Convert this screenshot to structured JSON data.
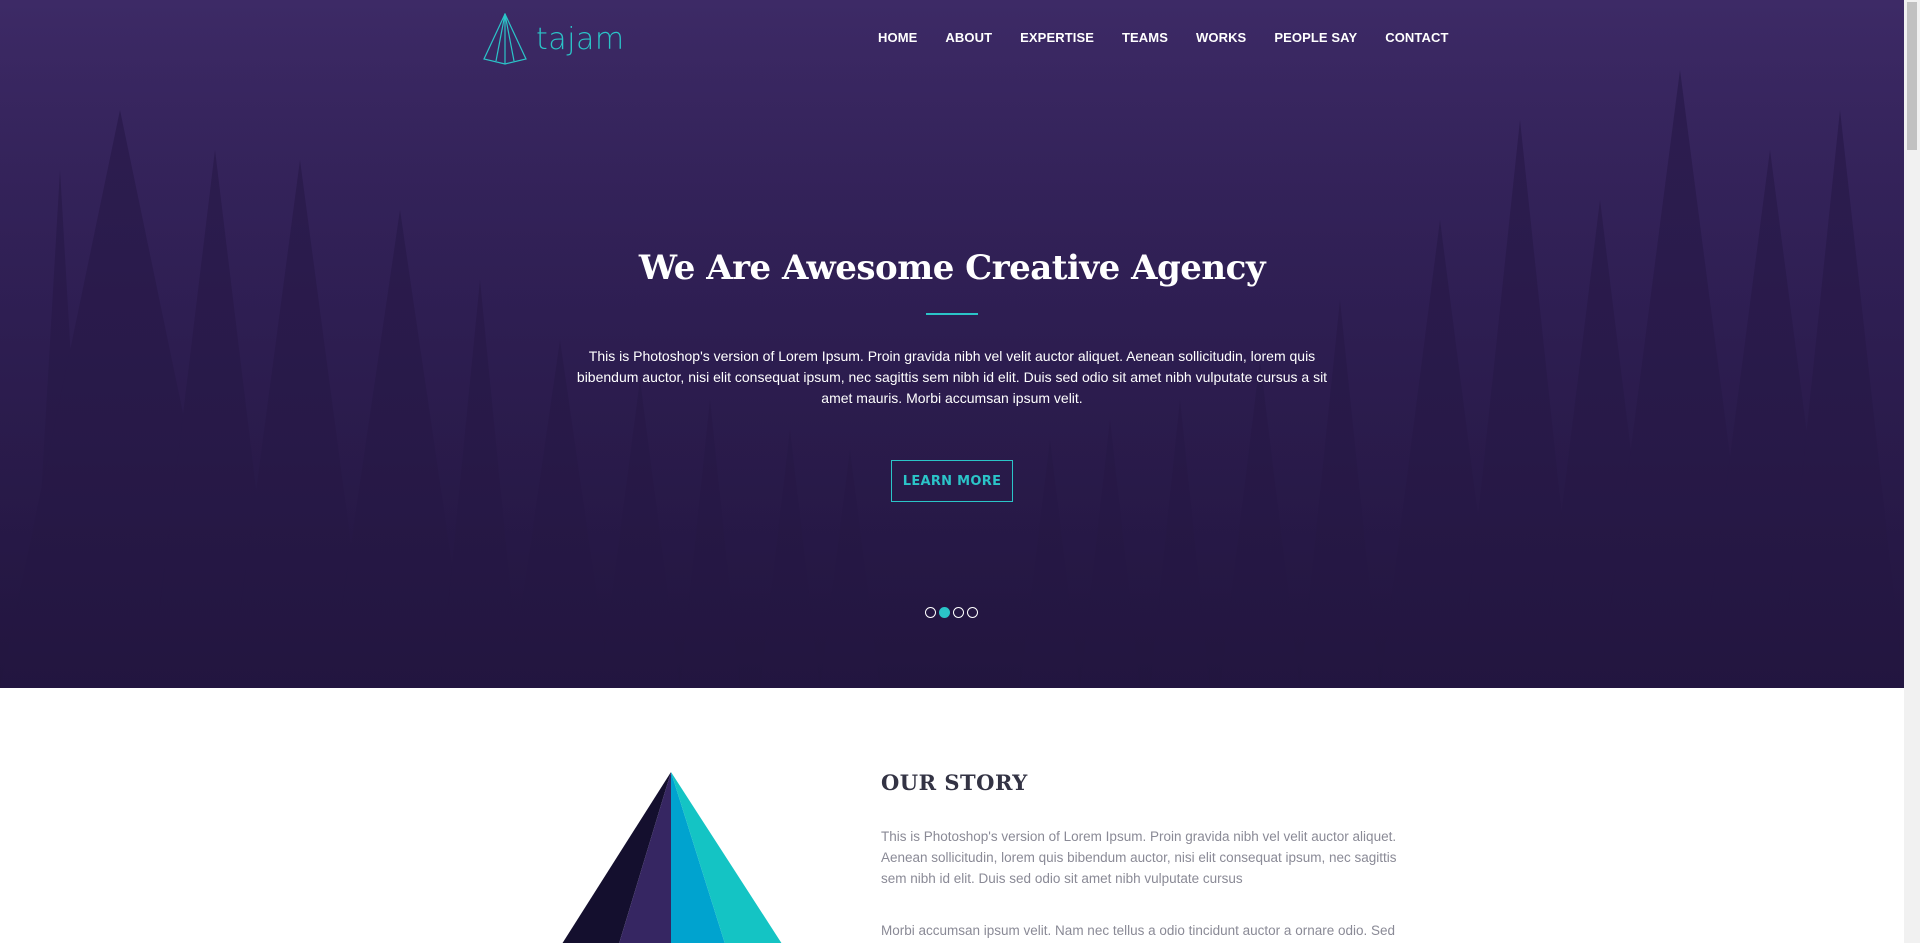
{
  "brand": {
    "name": "tajam",
    "accent_color": "#2bc4c8",
    "logo_icon": "pyramid-outline-icon"
  },
  "nav": {
    "items": [
      {
        "label": "HOME"
      },
      {
        "label": "ABOUT"
      },
      {
        "label": "EXPERTISE"
      },
      {
        "label": "TEAMS"
      },
      {
        "label": "WORKS"
      },
      {
        "label": "PEOPLE SAY"
      },
      {
        "label": "CONTACT"
      }
    ]
  },
  "hero": {
    "title": "We Are Awesome Creative Agency",
    "text": "This is Photoshop's version of Lorem Ipsum. Proin gravida nibh vel velit auctor aliquet. Aenean sollicitudin, lorem quis bibendum auctor, nisi elit consequat ipsum, nec sagittis sem nibh id elit. Duis sed odio sit amet nibh vulputate cursus a sit amet mauris. Morbi accumsan ipsum velit.",
    "button_label": "LEARN MORE",
    "slider": {
      "count": 4,
      "active_index": 1
    },
    "background_color": "#3a2862"
  },
  "story": {
    "title": "OUR STORY",
    "paragraph1": "This is Photoshop's version of Lorem Ipsum. Proin gravida nibh vel velit auctor aliquet. Aenean sollicitudin, lorem quis bibendum auctor, nisi elit consequat ipsum, nec sagittis sem nibh id elit. Duis sed odio sit amet nibh vulputate cursus",
    "paragraph2": "Morbi accumsan ipsum velit. Nam nec tellus a odio tincidunt auctor a ornare odio. Sed",
    "image_icon": "pyramid-illustration",
    "colors": [
      "#140f2e",
      "#362662",
      "#00a3cf",
      "#14c4c4"
    ]
  }
}
